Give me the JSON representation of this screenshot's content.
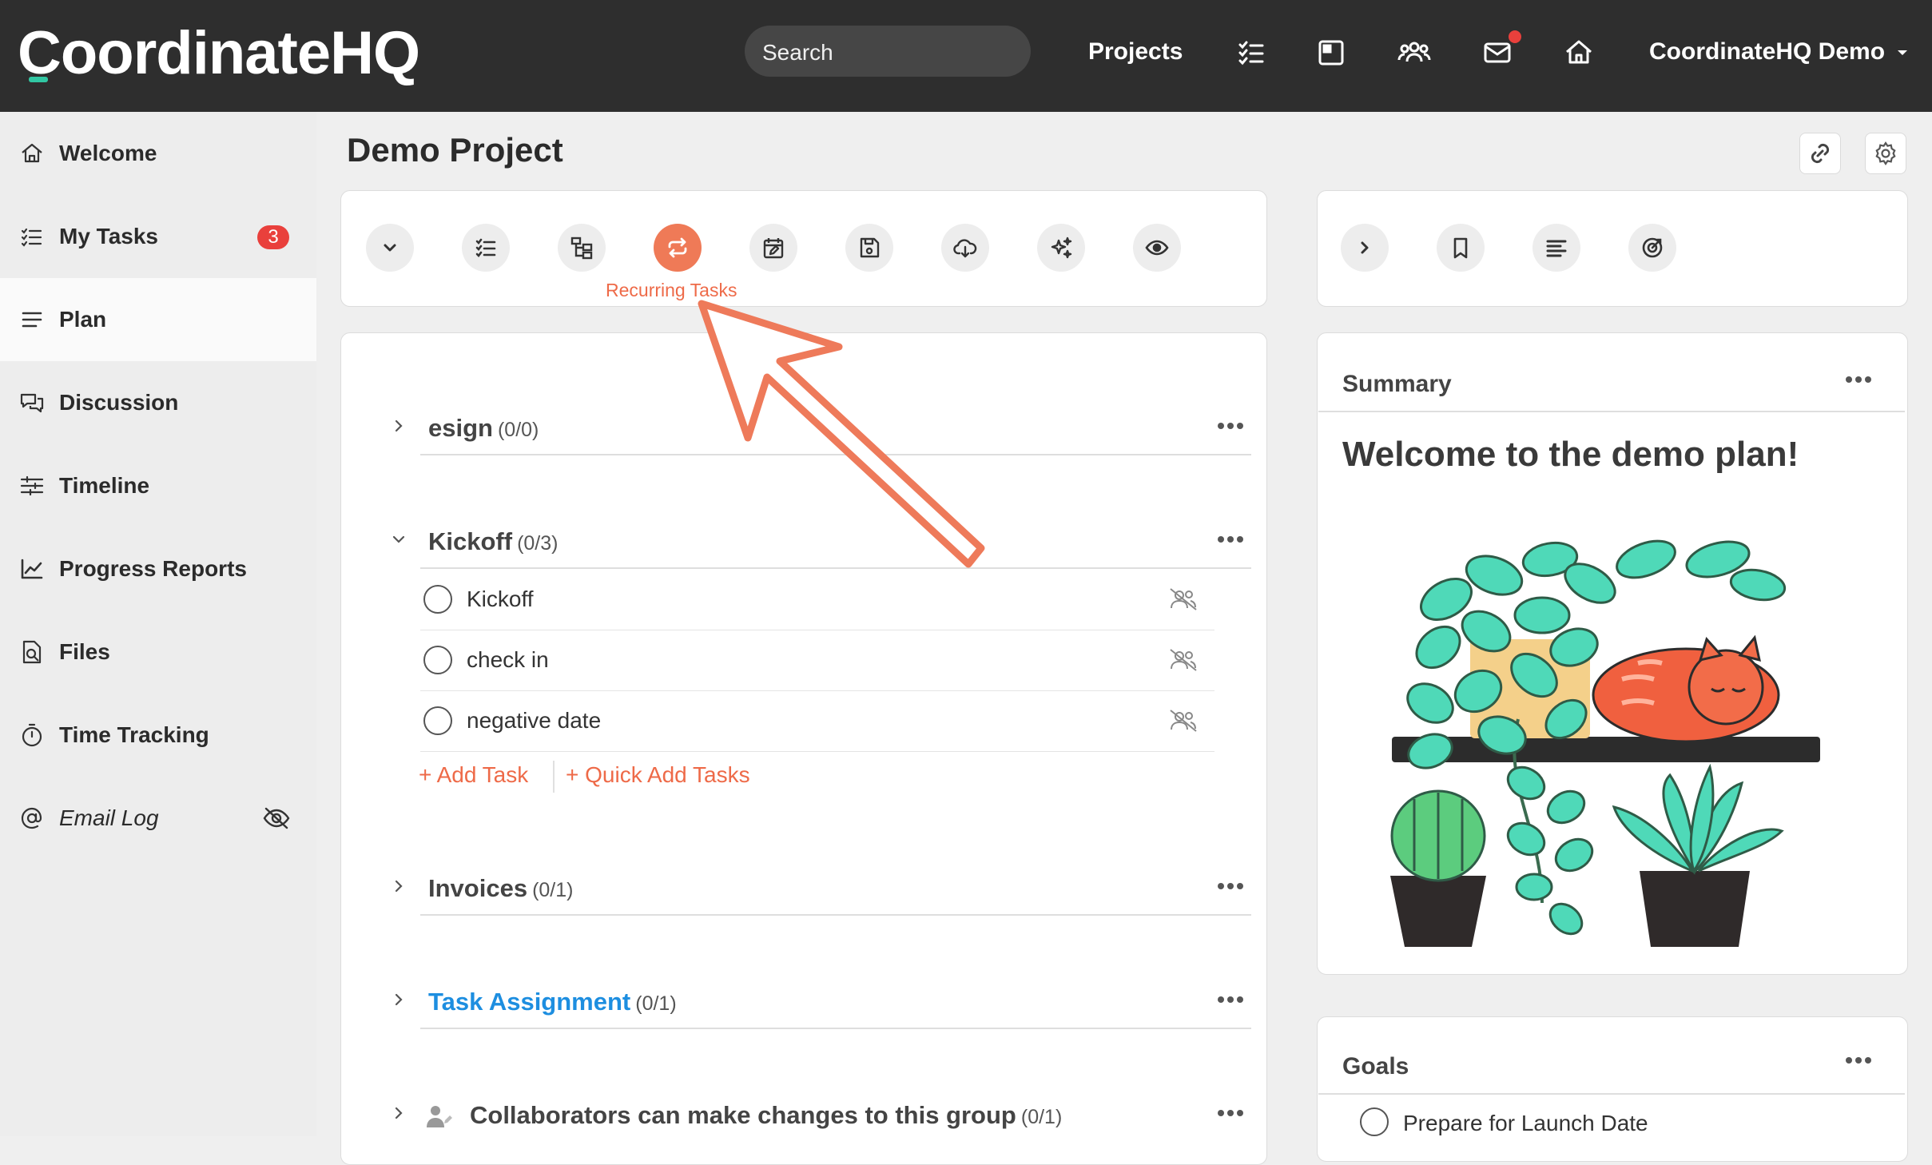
{
  "app": {
    "logo_text": "CoordinateHQ"
  },
  "topbar": {
    "search_placeholder": "Search",
    "projects_label": "Projects",
    "user_label": "CoordinateHQ Demo"
  },
  "sidebar": {
    "items": [
      {
        "label": "Welcome",
        "icon": "home-icon"
      },
      {
        "label": "My Tasks",
        "icon": "tasks-icon",
        "badge": "3"
      },
      {
        "label": "Plan",
        "icon": "plan-icon",
        "active": true
      },
      {
        "label": "Discussion",
        "icon": "discussion-icon"
      },
      {
        "label": "Timeline",
        "icon": "timeline-icon"
      },
      {
        "label": "Progress Reports",
        "icon": "chart-icon"
      },
      {
        "label": "Files",
        "icon": "file-search-icon"
      },
      {
        "label": "Time Tracking",
        "icon": "stopwatch-icon"
      },
      {
        "label": "Email Log",
        "icon": "at-icon",
        "trailing_icon": "eye-slash-icon"
      }
    ]
  },
  "page": {
    "title": "Demo Project"
  },
  "toolbar": {
    "tooltip": "Recurring Tasks",
    "buttons": [
      "chevron-down-icon",
      "checklist-icon",
      "hierarchy-icon",
      "recurring-icon",
      "calendar-edit-icon",
      "save-icon",
      "cloud-download-icon",
      "sparkles-icon",
      "eye-icon"
    ]
  },
  "plan": {
    "groups": [
      {
        "title": "esign",
        "count": "(0/0)"
      },
      {
        "title": "Kickoff",
        "count": "(0/3)",
        "expanded": true,
        "tasks": [
          "Kickoff",
          "check in",
          "negative date"
        ]
      },
      {
        "title": "Invoices",
        "count": "(0/1)"
      },
      {
        "title": "Task Assignment",
        "count": "(0/1)"
      },
      {
        "title": "Collaborators can make changes to this group",
        "count": "(0/1)"
      }
    ],
    "add_task": "+ Add Task",
    "quick_add": "+ Quick Add Tasks"
  },
  "right_panel": {
    "buttons": [
      "chevron-right-icon",
      "bookmark-icon",
      "align-left-icon",
      "target-icon"
    ],
    "summary": {
      "title": "Summary",
      "welcome": "Welcome to the demo plan!"
    },
    "goals": {
      "title": "Goals",
      "items": [
        "Prepare for Launch Date"
      ]
    }
  },
  "colors": {
    "accent": "#ee6a48",
    "topbar": "#2e2e2e",
    "link": "#1d8ee0",
    "badge": "#e9403c",
    "logo_accent": "#31c7a3"
  }
}
